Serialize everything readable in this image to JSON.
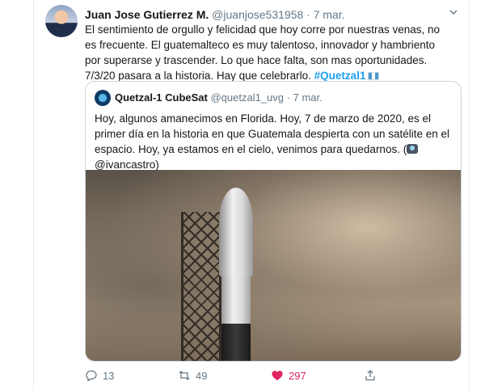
{
  "tweet": {
    "author_name": "Juan Jose Gutierrez M.",
    "author_handle": "@juanjose531958",
    "separator": "·",
    "time": "7 mar.",
    "text_main": "El sentimiento de orgullo y felicidad que hoy corre por nuestras venas, no es frecuente. El guatemalteco es muy talentoso, innovador y hambriento por superarse y trascender. Lo que hace falta, son mas oportunidades.  7/3/20 pasara a la historia.  Hay que celebrarlo. ",
    "hashtag": "#Quetzal1",
    "caret_icon": "chevron-down-icon"
  },
  "quote": {
    "name": "Quetzal-1 CubeSat",
    "handle": "@quetzal1_uvg",
    "separator": "·",
    "time": "7 mar.",
    "text": "Hoy, algunos amanecimos en Florida. Hoy, 7 de marzo de 2020, es el primer día en la historia en que Guatemala despierta con un satélite en el espacio. Hoy, ya estamos en el cielo, venimos para quedarnos. (",
    "mention": "@ivancastro)"
  },
  "actions": {
    "reply_count": "13",
    "retweet_count": "49",
    "like_count": "297"
  },
  "colors": {
    "accent": "#1da1f2",
    "like": "#e0245e",
    "muted": "#657786"
  }
}
